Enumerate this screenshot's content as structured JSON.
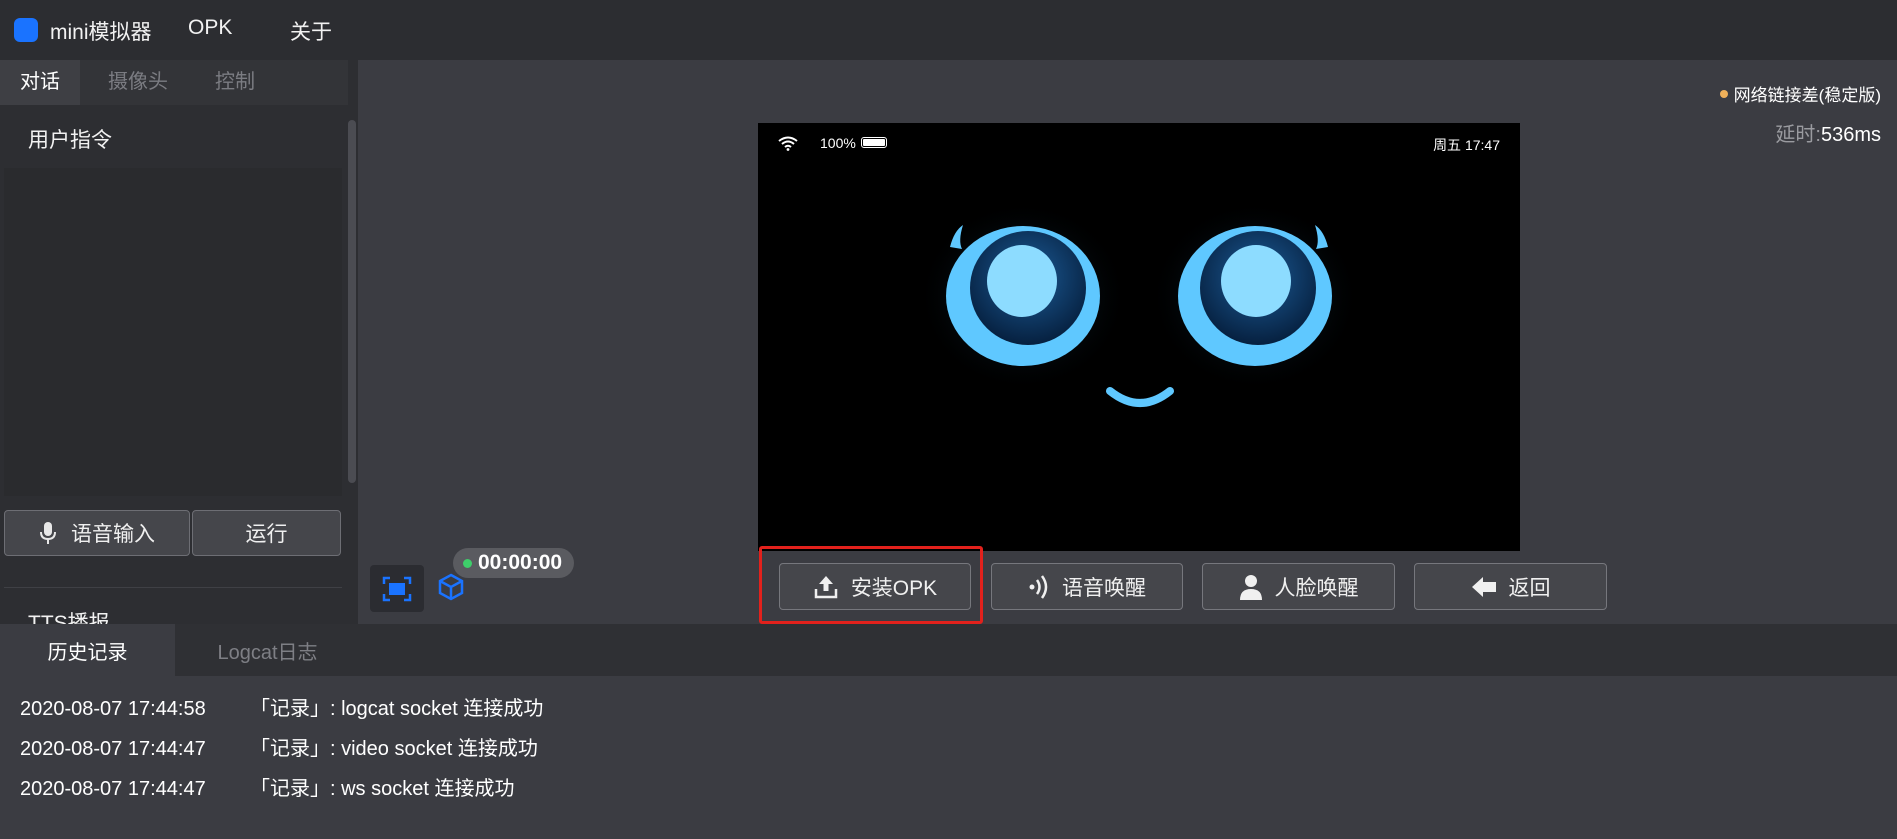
{
  "titlebar": {
    "app_title": "mini模拟器",
    "menu": [
      "OPK",
      "关于"
    ]
  },
  "sidebar": {
    "tabs": [
      {
        "label": "对话",
        "active": true
      },
      {
        "label": "摄像头",
        "active": false
      },
      {
        "label": "控制",
        "active": false
      }
    ],
    "user_command_title": "用户指令",
    "voice_input_label": "语音输入",
    "run_label": "运行",
    "tts_title": "TTS播报"
  },
  "network": {
    "status": "网络链接差(稳定版)",
    "latency_prefix": "延时:",
    "latency_value": "536ms",
    "status_color": "#f0b15a"
  },
  "device": {
    "battery": "100%",
    "time": "周五 17:47",
    "face_color": "#5fc8ff"
  },
  "controls": {
    "install_label": "安装OPK",
    "voice_wake_label": "语音唤醒",
    "face_wake_label": "人脸唤醒",
    "back_label": "返回"
  },
  "timer": {
    "value": "00:00:00",
    "status_color": "#3ecf6a"
  },
  "accent_color": "#1a73ff",
  "highlight_color": "#e2211c",
  "bottom": {
    "tabs": [
      {
        "label": "历史记录",
        "active": true
      },
      {
        "label": "Logcat日志",
        "active": false
      }
    ],
    "logs": [
      {
        "time": "2020-08-07 17:44:58",
        "message": "「记录」: logcat socket 连接成功"
      },
      {
        "time": "2020-08-07 17:44:47",
        "message": "「记录」: video socket 连接成功"
      },
      {
        "time": "2020-08-07 17:44:47",
        "message": "「记录」: ws socket 连接成功"
      }
    ]
  }
}
